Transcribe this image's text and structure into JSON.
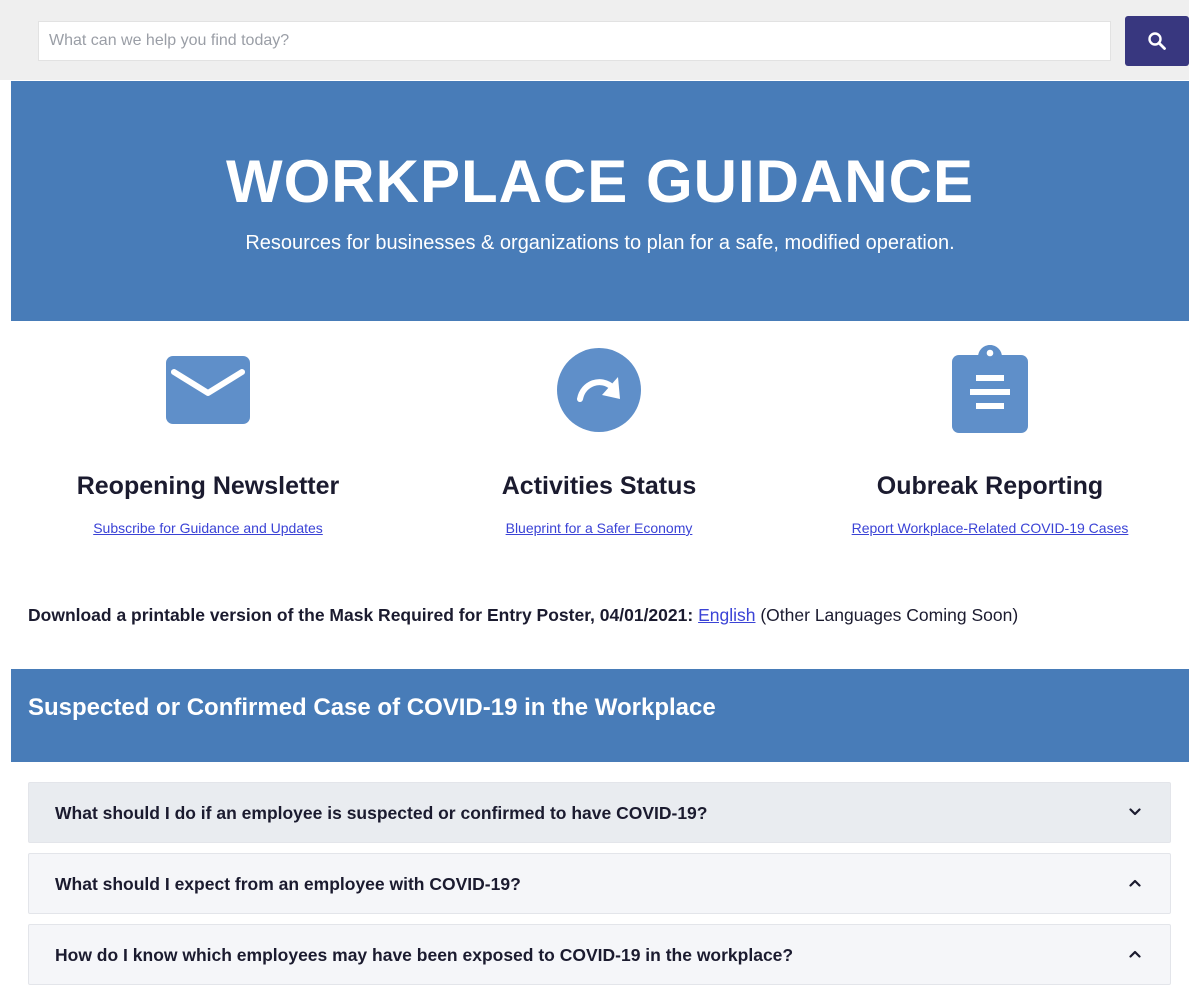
{
  "search": {
    "placeholder": "What can we help you find today?",
    "button_icon": "search-icon"
  },
  "hero": {
    "title": "WORKPLACE GUIDANCE",
    "subtitle": "Resources for businesses & organizations to plan for a safe, modified operation."
  },
  "features": [
    {
      "icon": "envelope-icon",
      "title": "Reopening Newsletter",
      "link": "Subscribe for Guidance and Updates"
    },
    {
      "icon": "redo-arrow-icon",
      "title": "Activities Status",
      "link": "Blueprint for a Safer Economy"
    },
    {
      "icon": "clipboard-icon",
      "title": "Oubreak Reporting",
      "link": "Report Workplace-Related COVID-19 Cases"
    }
  ],
  "download": {
    "lead": "Download a printable version of the Mask Required for Entry Poster, 04/01/2021:",
    "link": "English",
    "note": "(Other Languages Coming Soon)"
  },
  "section": {
    "title": "Suspected or Confirmed Case of COVID-19 in the Workplace"
  },
  "accordion": [
    {
      "question": "What should I do if an employee is suspected or confirmed to have COVID-19?",
      "chevron": "chevron-down-icon"
    },
    {
      "question": "What should I expect from an employee with COVID-19?",
      "chevron": "chevron-up-icon"
    },
    {
      "question": "How do I know which employees may have been exposed to COVID-19 in the workplace?",
      "chevron": "chevron-up-icon"
    }
  ],
  "colors": {
    "brand_blue": "#487cb8",
    "icon_blue": "#5f8fc9",
    "search_button": "#38377f",
    "link": "#3b43d6",
    "text_dark": "#1b1b2f"
  }
}
